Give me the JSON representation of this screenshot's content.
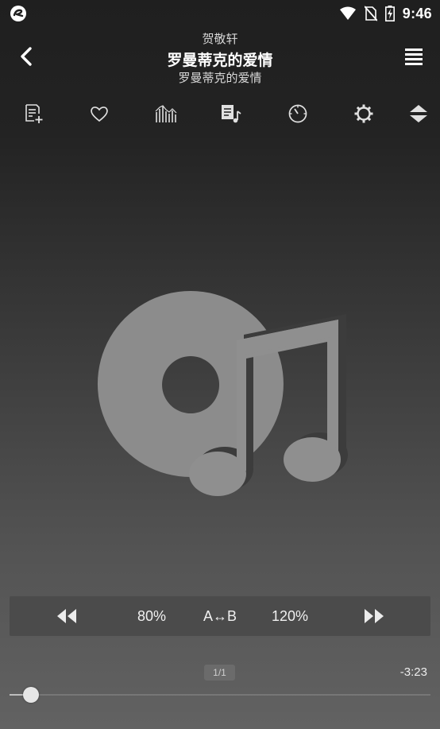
{
  "status_bar": {
    "time": "9:46",
    "icons": [
      "app-logo-icon",
      "wifi-icon",
      "no-sim-icon",
      "battery-charging-icon"
    ]
  },
  "header": {
    "artist": "贺敬轩",
    "title": "罗曼蒂克的爱情",
    "album": "罗曼蒂克的爱情",
    "back_icon": "chevron-left-icon",
    "menu_icon": "list-menu-icon"
  },
  "toolbar": {
    "items": [
      {
        "name": "add-to-playlist",
        "icon": "playlist-add-icon"
      },
      {
        "name": "favorite",
        "icon": "heart-icon"
      },
      {
        "name": "equalizer",
        "icon": "equalizer-icon"
      },
      {
        "name": "queue",
        "icon": "queue-music-icon"
      },
      {
        "name": "sleep-timer",
        "icon": "timer-icon"
      },
      {
        "name": "settings",
        "icon": "gear-icon"
      },
      {
        "name": "expand-collapse",
        "icon": "up-down-arrows-icon"
      }
    ]
  },
  "album_art": {
    "icon": "disc-music-note-icon"
  },
  "ab_panel": {
    "rewind_icon": "rewind-icon",
    "speed_down_label": "80%",
    "ab_label": "A↔B",
    "speed_up_label": "120%",
    "forward_icon": "fast-forward-icon"
  },
  "playback": {
    "page_indicator": "1/1",
    "remaining_time": "-3:23",
    "progress": 0.05
  },
  "colors": {
    "background_top": "#1f1f1f",
    "background_bottom": "#626262",
    "art_gray": "#8c8c8c",
    "panel": "#4b4b4b"
  }
}
